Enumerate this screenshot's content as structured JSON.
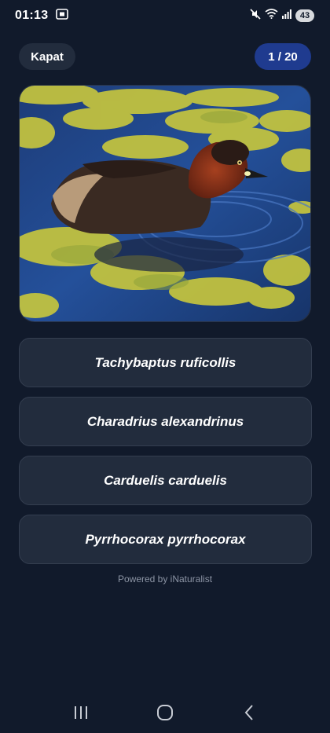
{
  "status_bar": {
    "time": "01:13",
    "battery": "43",
    "icons": [
      "screenshot-icon",
      "mute-icon",
      "wifi-icon",
      "signal-icon"
    ]
  },
  "header": {
    "close_label": "Kapat",
    "progress": "1 / 20"
  },
  "photo": {
    "subject": "bird-photo"
  },
  "answers": [
    {
      "label": "Tachybaptus ruficollis"
    },
    {
      "label": "Charadrius alexandrinus"
    },
    {
      "label": "Carduelis carduelis"
    },
    {
      "label": "Pyrrhocorax pyrrhocorax"
    }
  ],
  "footer": {
    "powered_by": "Powered by iNaturalist"
  },
  "nav": {
    "icons": [
      "recent-apps-icon",
      "home-icon",
      "back-icon"
    ]
  },
  "colors": {
    "background": "#111a2b",
    "surface": "#222c3d",
    "accent": "#1f3b8f"
  }
}
